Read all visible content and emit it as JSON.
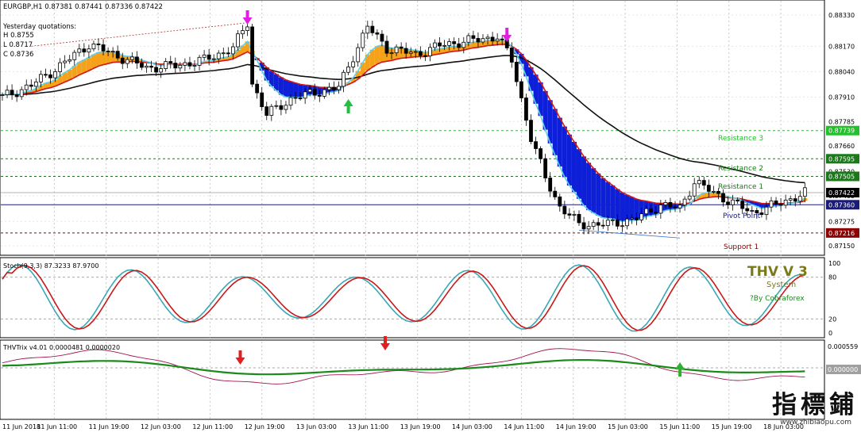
{
  "main": {
    "symbol_header": "EURGBP,H1  0.87381 0.87441 0.87336 0.87422",
    "yesterday": {
      "title": "Yesterday quotations:",
      "high": "H 0.8755",
      "low": "L 0.8717",
      "close": "C 0.8736"
    },
    "levels": [
      {
        "label": "Resistance 3",
        "price": 0.87739,
        "price_text": "0.87739",
        "color": "#22c02a",
        "dash": true
      },
      {
        "label": "Resistance 2",
        "price": 0.87595,
        "price_text": "0.87595",
        "color": "#1a7a1a",
        "dash": true
      },
      {
        "label": "Resistance 1",
        "price": 0.87505,
        "price_text": "0.87505",
        "color": "#1a7a1a",
        "dash": true
      },
      {
        "label": "Pivot Point",
        "price": 0.8736,
        "price_text": "0.87360",
        "color": "#1a1a7a",
        "dash": false
      },
      {
        "label": "Support 1",
        "price": 0.87216,
        "price_text": "0.87216",
        "color": "#8b0000",
        "dash": true
      }
    ],
    "current_price": {
      "value": 0.87422,
      "text": "0.87422",
      "color": "#000000"
    },
    "price_ticks": [
      "0.88330",
      "0.88170",
      "0.88040",
      "0.87910",
      "0.87785",
      "0.87660",
      "0.87530",
      "0.87405",
      "0.87275",
      "0.87150"
    ],
    "price_range": [
      0.8711,
      0.8839
    ]
  },
  "stoch": {
    "header": "Stoch(9,3,3) 87.3233 87.9700",
    "ticks": [
      "100",
      "80",
      "20",
      "0"
    ],
    "logo_title": "THV V 3",
    "logo_system": "System",
    "logo_by": "?By Cobraforex"
  },
  "trix": {
    "header": "THVTrix v4.01 0.0000481 0.0000020",
    "ticks": [
      "0.000559",
      "0.000000"
    ]
  },
  "time_axis": [
    "11 Jun 2018",
    "11 Jun 11:00",
    "11 Jun 19:00",
    "12 Jun 03:00",
    "12 Jun 11:00",
    "12 Jun 19:00",
    "13 Jun 03:00",
    "13 Jun 11:00",
    "13 Jun 19:00",
    "14 Jun 03:00",
    "14 Jun 11:00",
    "14 Jun 19:00",
    "15 Jun 03:00",
    "15 Jun 11:00",
    "15 Jun 19:00",
    "18 Jun 03:00"
  ],
  "watermark": {
    "chinese": "指標鋪",
    "url": "www.zhibiaopu.com"
  },
  "colors": {
    "bull_candle": "#ffffff",
    "bear_candle": "#000000",
    "cloud_orange": "#f5a11a",
    "cloud_blue": "#0e1fd8",
    "ema_fast": "#5fd0e8",
    "ema_slow": "#d01818",
    "sma_long": "#111111",
    "stoch_main": "#3aa7b4",
    "stoch_signal": "#c81818",
    "trix_up": "#1a8a1a",
    "trix_down": "#a01550"
  },
  "icons": {
    "sell_arrow": "magenta-down-arrow",
    "buy_arrow": "green-up-arrow",
    "trix_sell": "red-down-arrow",
    "trix_buy": "green-up-arrow"
  }
}
